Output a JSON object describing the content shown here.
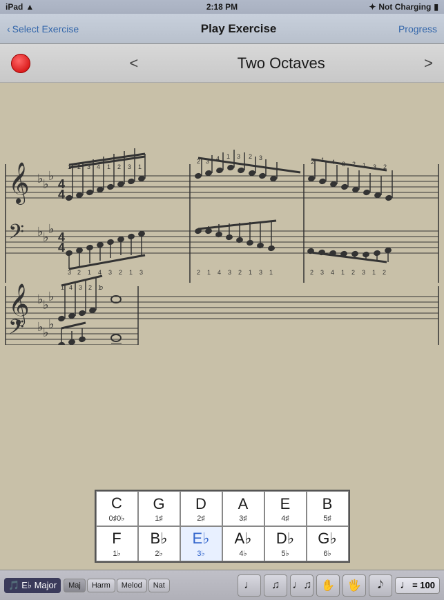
{
  "status_bar": {
    "carrier": "iPad",
    "wifi_icon": "wifi",
    "time": "2:18 PM",
    "bluetooth_icon": "bluetooth",
    "charging_text": "Not Charging",
    "battery_icon": "battery"
  },
  "nav_bar": {
    "back_arrow": "‹",
    "back_label": "Select Exercise",
    "title": "Play Exercise",
    "right_label": "Progress"
  },
  "exercise_header": {
    "prev_arrow": "<",
    "title": "Two Octaves",
    "next_arrow": ">"
  },
  "key_table": {
    "rows": [
      [
        {
          "letter": "C",
          "sub": "0♯0♭",
          "blue": false
        },
        {
          "letter": "G",
          "sub": "1♯",
          "blue": false
        },
        {
          "letter": "D",
          "sub": "2♯",
          "blue": false
        },
        {
          "letter": "A",
          "sub": "3♯",
          "blue": false
        },
        {
          "letter": "E",
          "sub": "4♯",
          "blue": false
        },
        {
          "letter": "B",
          "sub": "5♯",
          "blue": false
        }
      ],
      [
        {
          "letter": "F",
          "sub": "1♭",
          "blue": false
        },
        {
          "letter": "B♭",
          "sub": "2♭",
          "blue": false
        },
        {
          "letter": "E♭",
          "sub": "3♭",
          "blue": true
        },
        {
          "letter": "A♭",
          "sub": "4♭",
          "blue": false
        },
        {
          "letter": "D♭",
          "sub": "5♭",
          "blue": false
        },
        {
          "letter": "G♭",
          "sub": "6♭",
          "blue": false
        }
      ]
    ]
  },
  "bottom_bar": {
    "key_icon": "🎵",
    "key_name": "E♭ Major",
    "modes": [
      "Maj",
      "Harm",
      "Melod",
      "Nat"
    ],
    "active_mode": "Maj",
    "icon_buttons": [
      "♩",
      "♫",
      "♩♫"
    ],
    "hand_icons": [
      "✋",
      "🖐"
    ],
    "metronome_icon": "🔔",
    "tempo_label": "= 100"
  }
}
